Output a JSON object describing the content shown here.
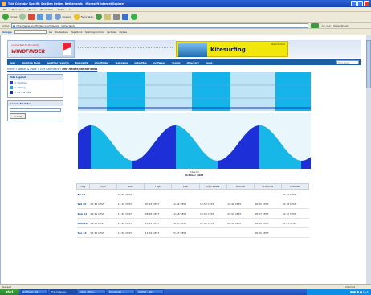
{
  "window": {
    "title": "Tide Calendar Specific Sea Den Helder, Netherlands - Microsoft Internet Explorer",
    "menu": [
      "File",
      "Bewerken",
      "Beeld",
      "Favorieten",
      "Extra",
      "?"
    ]
  },
  "toolbar": {
    "back_label": "Vorige",
    "search_label": "Zoeken",
    "favorites_label": "Favorieten"
  },
  "address": {
    "label": "Adres",
    "url": "http://www.windfinder.com/tide/tide_netherlands",
    "go_label": "Ga naar",
    "links_label": "Koppelingen"
  },
  "googlebar": {
    "brand": "Google",
    "go_label": "Ga",
    "items": [
      "Bladwijzers",
      "PageRank",
      "Spellingcontrole",
      "Vertalen",
      "Opties"
    ]
  },
  "banner": {
    "connected": "connected to the wind",
    "logo_text": "WINDFINDER",
    "ad_title": "Kitesurfing",
    "ad_small": "Kitesurfschool"
  },
  "nav": {
    "items": [
      "map",
      "desktop tools",
      "weather reports",
      "forecasts",
      "windfinder",
      "webcams",
      "satellites",
      "surfwave",
      "forum",
      "directory",
      "news"
    ],
    "search_placeholder": "Find spots"
  },
  "breadcrumb": {
    "home": "Home",
    "waves": "Waves & more",
    "tide": "Tide Calendars",
    "current": "Den Helder, Netherlands"
  },
  "sidebar": {
    "legend_title": "Tide legend",
    "legend_items": [
      {
        "label": "= flooding",
        "color": "#1f3fd8"
      },
      {
        "label": "= ebbing",
        "color": "#3aa0e6"
      },
      {
        "label": "= turn of tide",
        "color": "#1a2fa0"
      }
    ],
    "search_title": "Search for tides",
    "search_button": "Search"
  },
  "chart_data": {
    "type": "area",
    "caption_line1": "Tides for",
    "caption_line2": "October 2007",
    "colors": {
      "flood": "#1d2fd6",
      "ebb": "#17b8e8",
      "land": "#3f8c6a",
      "grid": "#9fb3d8"
    }
  },
  "table": {
    "headers": [
      "Day",
      "High",
      "Low",
      "High",
      "Low",
      "High Peaks",
      "Sunrise",
      "Moonrise",
      "Moonset"
    ],
    "rows": [
      {
        "day": "Fri 19",
        "cells": [
          "",
          "10:46 CEST",
          "",
          "",
          "",
          "",
          "",
          "16:17 CEST",
          "21:55 CEST"
        ]
      },
      {
        "day": "Sat 20",
        "cells": [
          "00:36 CEST",
          "11:16 CEST",
          "07:23 CEST",
          "14:44 CEST",
          "13:53 CEST",
          "11:40 CEST",
          "08:15 CEST",
          "16:18 CEST",
          "16:17 CEST"
        ]
      },
      {
        "day": "Sun 21",
        "cells": [
          "02:21 CEST",
          "11:46 CEST",
          "08:45 CEST",
          "14:58 CEST",
          "15:00 CEST",
          "21:37 CEST",
          "08:17 CEST",
          "16:32 CEST",
          "01:23 CEST"
        ]
      },
      {
        "day": "Mon 22",
        "cells": [
          "03:23 CEST",
          "12:10 CEST",
          "10:12 CEST",
          "16:33 CEST",
          "17:06 CEST",
          "22:30 CEST",
          "08:19 CEST",
          "16:51 CEST",
          "02:44 CEST"
        ]
      },
      {
        "day": "Tue 23",
        "cells": [
          "05:30 CEST",
          "11:56 CEST",
          "11:52 CEST",
          "23:47 CEST",
          "",
          "",
          "08:20 CEST",
          "",
          "04:17 CEST"
        ]
      }
    ]
  },
  "status": {
    "left": "Gereed",
    "zone": "Internet"
  },
  "taskbar": {
    "start_label": "start",
    "tasks": [
      "windfinder - Mi...",
      "Tide Calendar...",
      "Inbox - Micro...",
      "Document1 - ...",
      "Untitled - Not..."
    ],
    "clock": "16:17"
  }
}
